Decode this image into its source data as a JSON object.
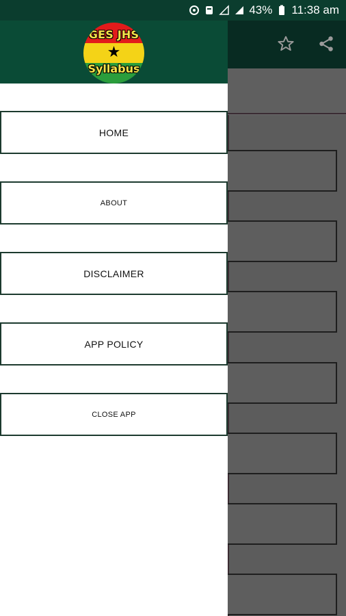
{
  "status_bar": {
    "battery": "43%",
    "time": "11:38 am"
  },
  "toolbar": {
    "actions": [
      "star-icon",
      "share-icon"
    ]
  },
  "drawer": {
    "logo": {
      "line1": "GES JHS",
      "line2": "Syllabus"
    },
    "menu": [
      {
        "label": "HOME"
      },
      {
        "label": "ABOUT"
      },
      {
        "label": "DISCLAIMER"
      },
      {
        "label": "APP POLICY"
      },
      {
        "label": "CLOSE APP"
      }
    ]
  },
  "colors": {
    "status_bar": "#0b3d2e",
    "drawer_header": "#0a4b36",
    "logo_red": "#e21b1b",
    "logo_yellow": "#f4d317",
    "logo_green": "#2b9d3c"
  }
}
